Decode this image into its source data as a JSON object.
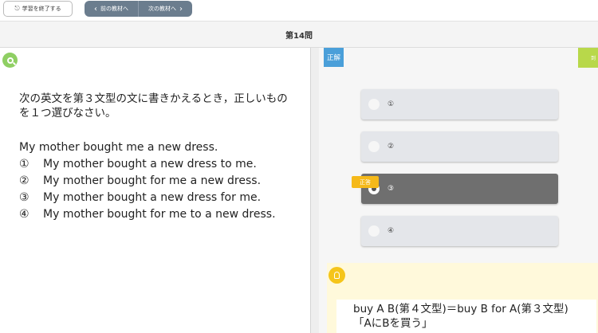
{
  "toolbar": {
    "end_label": "学習を終了する",
    "prev_label": "前の教材へ",
    "next_label": "次の教材へ"
  },
  "title": "第14問",
  "question": {
    "instruction": "次の英文を第３文型の文に書きかえるとき，正しいものを１つ選びなさい。",
    "sentence": "My mother bought me a new dress.",
    "options": [
      {
        "num": "①",
        "text": "My mother bought a new dress to me."
      },
      {
        "num": "②",
        "text": "My mother bought for me a new dress."
      },
      {
        "num": "③",
        "text": "My mother bought a new dress for me."
      },
      {
        "num": "④",
        "text": "My mother bought for me to a new dress."
      }
    ]
  },
  "answer_panel": {
    "tag": "正解",
    "corner_tag": "到",
    "correct_badge": "正答",
    "choices": [
      "①",
      "②",
      "③",
      "④"
    ],
    "selected_index": 2
  },
  "explanation": {
    "line1": "buy A B(第４文型)＝buy B for A(第３文型)",
    "line2": "「AにBを買う」"
  },
  "colors": {
    "nav_bg": "#6b7d8e",
    "question_icon": "#8fcf63",
    "answer_tag": "#4a9fd9",
    "correct_badge": "#f5b91a",
    "selected_choice": "#6f6f6f",
    "hint_bg": "#fff9db"
  },
  "icons": {
    "end": "exit-icon",
    "prev": "chevron-left-icon",
    "next": "chevron-right-icon",
    "question": "search-icon",
    "hint": "lightbulb-icon"
  }
}
